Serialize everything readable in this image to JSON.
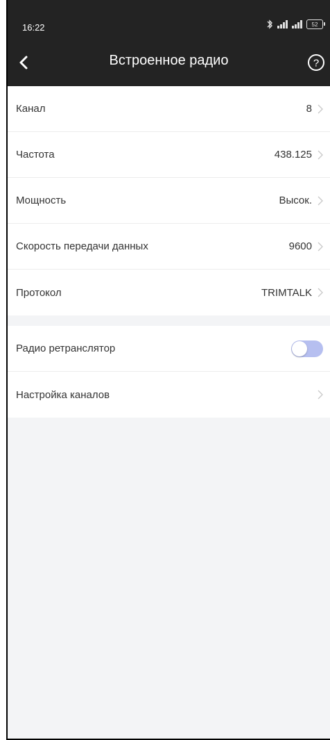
{
  "status": {
    "time": "16:22",
    "battery": "52"
  },
  "header": {
    "title": "Встроенное радио"
  },
  "settings": [
    {
      "label": "Канал",
      "value": "8"
    },
    {
      "label": "Частота",
      "value": "438.125"
    },
    {
      "label": "Мощность",
      "value": "Высок."
    },
    {
      "label": "Скорость передачи данных",
      "value": "9600"
    },
    {
      "label": "Протокол",
      "value": "TRIMTALK"
    }
  ],
  "extra": {
    "repeater_label": "Радио ретранслятор",
    "repeater_on": false,
    "channel_setup_label": "Настройка каналов"
  },
  "colors": {
    "header_bg": "#232323",
    "toggle_track": "#b6bff0",
    "page_bg": "#f3f4f6"
  },
  "icons": {
    "back": "chevron-left-icon",
    "help": "question-circle-icon",
    "row_arrow": "chevron-right-icon",
    "bluetooth": "bluetooth-icon",
    "signal": "signal-icon",
    "battery": "battery-icon"
  }
}
